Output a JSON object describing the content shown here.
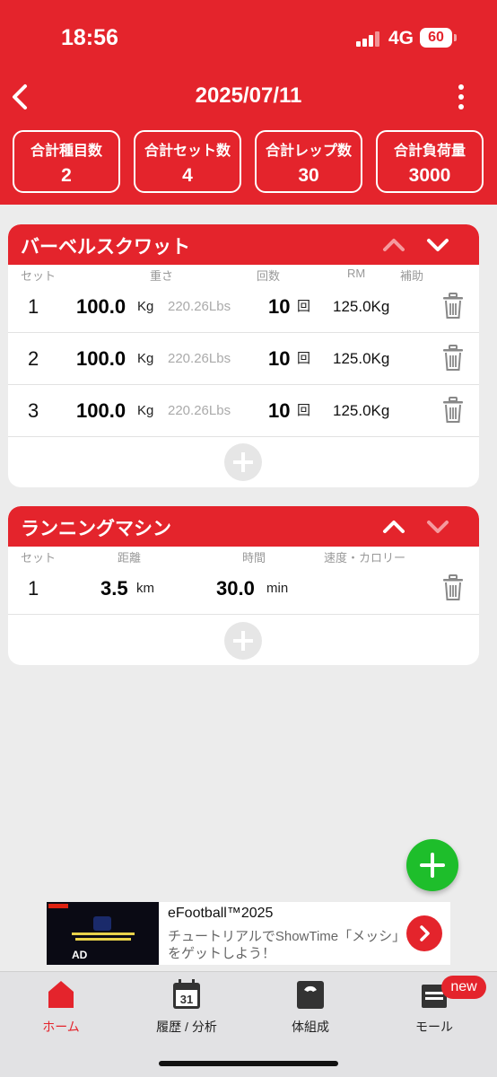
{
  "status_bar": {
    "time": "18:56",
    "network": "4G",
    "battery": "60"
  },
  "nav": {
    "title": "2025/07/11"
  },
  "summary": [
    {
      "label": "合計種目数",
      "value": "2"
    },
    {
      "label": "合計セット数",
      "value": "4"
    },
    {
      "label": "合計レップ数",
      "value": "30"
    },
    {
      "label": "合計負荷量",
      "value": "3000"
    }
  ],
  "exercise1": {
    "title": "バーベルスクワット",
    "columns": {
      "set": "セット",
      "weight": "重さ",
      "reps": "回数",
      "rm": "RM",
      "assist": "補助"
    },
    "units": {
      "kg": "Kg",
      "rep": "回"
    },
    "rows": [
      {
        "set": "1",
        "weight": "100.0",
        "lbs": "220.26Lbs",
        "reps": "10",
        "rm": "125.0Kg"
      },
      {
        "set": "2",
        "weight": "100.0",
        "lbs": "220.26Lbs",
        "reps": "10",
        "rm": "125.0Kg"
      },
      {
        "set": "3",
        "weight": "100.0",
        "lbs": "220.26Lbs",
        "reps": "10",
        "rm": "125.0Kg"
      }
    ]
  },
  "exercise2": {
    "title": "ランニングマシン",
    "columns": {
      "set": "セット",
      "distance": "距離",
      "time": "時間",
      "speed": "速度・カロリー"
    },
    "rows": [
      {
        "set": "1",
        "distance": "3.5",
        "distance_unit": "km",
        "time": "30.0",
        "time_unit": "min"
      }
    ]
  },
  "ad": {
    "thumb_badge": "AD",
    "title": "eFootball™2025",
    "description": "チュートリアルでShowTime「メッシ」をゲットしよう！"
  },
  "tabs": [
    {
      "label": "ホーム",
      "icon": "home-icon",
      "active": true
    },
    {
      "label": "履歴 / 分析",
      "icon": "calendar-icon",
      "calendar_day": "31"
    },
    {
      "label": "体組成",
      "icon": "scale-icon"
    },
    {
      "label": "モール",
      "icon": "store-icon"
    }
  ],
  "badge": {
    "new": "new"
  },
  "colors": {
    "primary": "#e4242c",
    "fab": "#1ebe2b",
    "background": "#ececec"
  }
}
